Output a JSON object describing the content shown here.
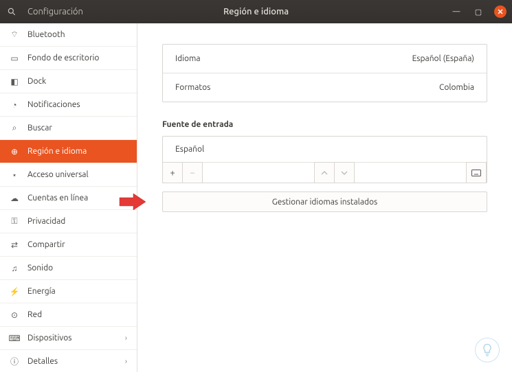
{
  "titlebar": {
    "app": "Configuración",
    "page": "Región e idioma"
  },
  "sidebar": {
    "items": [
      {
        "icon": "⌔",
        "label": "Bluetooth",
        "chev": false
      },
      {
        "icon": "▭",
        "label": "Fondo de escritorio",
        "chev": false
      },
      {
        "icon": "◧",
        "label": "Dock",
        "chev": false
      },
      {
        "icon": "◔",
        "label": "Notificaciones",
        "chev": false
      },
      {
        "icon": "⌕",
        "label": "Buscar",
        "chev": false
      },
      {
        "icon": "⊕",
        "label": "Región e idioma",
        "chev": false,
        "active": true
      },
      {
        "icon": "⋆",
        "label": "Acceso universal",
        "chev": false
      },
      {
        "icon": "☁",
        "label": "Cuentas en línea",
        "chev": false
      },
      {
        "icon": "⚿",
        "label": "Privacidad",
        "chev": false
      },
      {
        "icon": "⇄",
        "label": "Compartir",
        "chev": false
      },
      {
        "icon": "♫",
        "label": "Sonido",
        "chev": false
      },
      {
        "icon": "⚡",
        "label": "Energía",
        "chev": false
      },
      {
        "icon": "⊙",
        "label": "Red",
        "chev": false
      },
      {
        "icon": "⌨",
        "label": "Dispositivos",
        "chev": true
      },
      {
        "icon": "ⓘ",
        "label": "Detalles",
        "chev": true
      }
    ]
  },
  "main": {
    "rows": {
      "language_label": "Idioma",
      "language_value": "Español (España)",
      "formats_label": "Formatos",
      "formats_value": "Colombia"
    },
    "input_source": {
      "title": "Fuente de entrada",
      "entry": "Español"
    },
    "manage_button": "Gestionar idiomas instalados"
  }
}
